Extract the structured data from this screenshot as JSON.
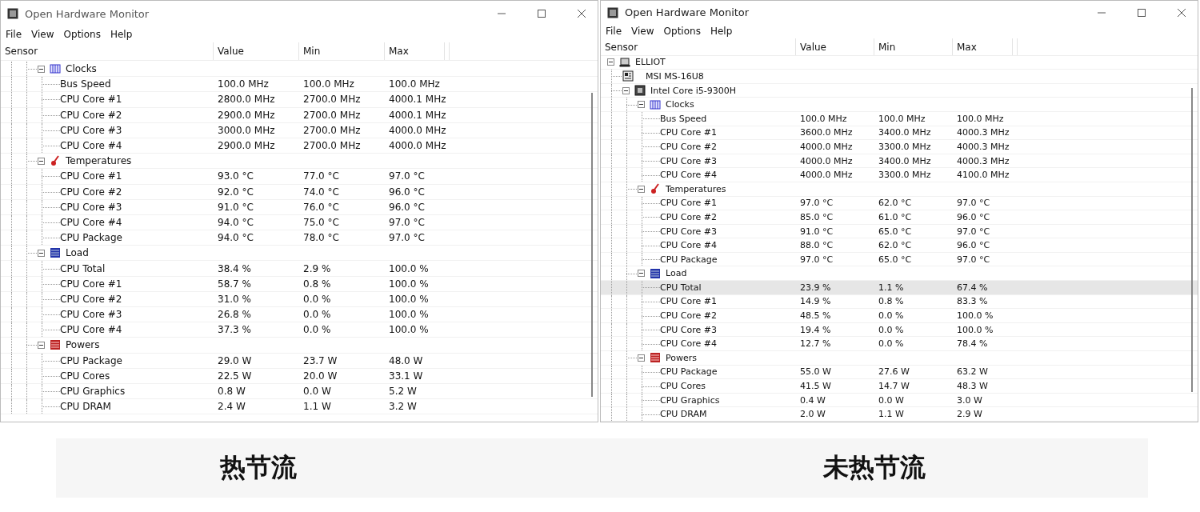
{
  "windows": [
    {
      "title": "Open Hardware Monitor",
      "menu": [
        "File",
        "View",
        "Options",
        "Help"
      ],
      "columns": [
        "Sensor",
        "Value",
        "Min",
        "Max"
      ],
      "caption": "热节流",
      "tree": [
        {
          "kind": "clocks",
          "name": "Clocks",
          "expanded": true,
          "selected": false,
          "children": [
            {
              "kind": "sensor",
              "name": "Bus Speed",
              "value": "100.0 MHz",
              "min": "100.0 MHz",
              "max": "100.0 MHz",
              "selected": false
            },
            {
              "kind": "sensor",
              "name": "CPU Core #1",
              "value": "2800.0 MHz",
              "min": "2700.0 MHz",
              "max": "4000.1 MHz",
              "selected": false
            },
            {
              "kind": "sensor",
              "name": "CPU Core #2",
              "value": "2900.0 MHz",
              "min": "2700.0 MHz",
              "max": "4000.1 MHz",
              "selected": false
            },
            {
              "kind": "sensor",
              "name": "CPU Core #3",
              "value": "3000.0 MHz",
              "min": "2700.0 MHz",
              "max": "4000.0 MHz",
              "selected": false
            },
            {
              "kind": "sensor",
              "name": "CPU Core #4",
              "value": "2900.0 MHz",
              "min": "2700.0 MHz",
              "max": "4000.0 MHz",
              "selected": false
            }
          ]
        },
        {
          "kind": "temperatures",
          "name": "Temperatures",
          "expanded": true,
          "selected": false,
          "children": [
            {
              "kind": "sensor",
              "name": "CPU Core #1",
              "value": "93.0 °C",
              "min": "77.0 °C",
              "max": "97.0 °C",
              "selected": false
            },
            {
              "kind": "sensor",
              "name": "CPU Core #2",
              "value": "92.0 °C",
              "min": "74.0 °C",
              "max": "96.0 °C",
              "selected": false
            },
            {
              "kind": "sensor",
              "name": "CPU Core #3",
              "value": "91.0 °C",
              "min": "76.0 °C",
              "max": "96.0 °C",
              "selected": false
            },
            {
              "kind": "sensor",
              "name": "CPU Core #4",
              "value": "94.0 °C",
              "min": "75.0 °C",
              "max": "97.0 °C",
              "selected": false
            },
            {
              "kind": "sensor",
              "name": "CPU Package",
              "value": "94.0 °C",
              "min": "78.0 °C",
              "max": "97.0 °C",
              "selected": false
            }
          ]
        },
        {
          "kind": "load",
          "name": "Load",
          "expanded": true,
          "selected": false,
          "children": [
            {
              "kind": "sensor",
              "name": "CPU Total",
              "value": "38.4 %",
              "min": "2.9 %",
              "max": "100.0 %",
              "selected": false
            },
            {
              "kind": "sensor",
              "name": "CPU Core #1",
              "value": "58.7 %",
              "min": "0.8 %",
              "max": "100.0 %",
              "selected": false
            },
            {
              "kind": "sensor",
              "name": "CPU Core #2",
              "value": "31.0 %",
              "min": "0.0 %",
              "max": "100.0 %",
              "selected": false
            },
            {
              "kind": "sensor",
              "name": "CPU Core #3",
              "value": "26.8 %",
              "min": "0.0 %",
              "max": "100.0 %",
              "selected": false
            },
            {
              "kind": "sensor",
              "name": "CPU Core #4",
              "value": "37.3 %",
              "min": "0.0 %",
              "max": "100.0 %",
              "selected": false
            }
          ]
        },
        {
          "kind": "powers",
          "name": "Powers",
          "expanded": true,
          "selected": false,
          "children": [
            {
              "kind": "sensor",
              "name": "CPU Package",
              "value": "29.0 W",
              "min": "23.7 W",
              "max": "48.0 W",
              "selected": false
            },
            {
              "kind": "sensor",
              "name": "CPU Cores",
              "value": "22.5 W",
              "min": "20.0 W",
              "max": "33.1 W",
              "selected": false
            },
            {
              "kind": "sensor",
              "name": "CPU Graphics",
              "value": "0.8 W",
              "min": "0.0 W",
              "max": "5.2 W",
              "selected": false
            },
            {
              "kind": "sensor",
              "name": "CPU DRAM",
              "value": "2.4 W",
              "min": "1.1 W",
              "max": "3.2 W",
              "selected": false
            }
          ]
        }
      ]
    },
    {
      "title": "Open Hardware Monitor",
      "menu": [
        "File",
        "View",
        "Options",
        "Help"
      ],
      "columns": [
        "Sensor",
        "Value",
        "Min",
        "Max"
      ],
      "caption": "未热节流",
      "tree": [
        {
          "kind": "computer",
          "name": "ELLIOT",
          "expanded": true,
          "selected": false,
          "children": [
            {
              "kind": "mainboard",
              "name": "MSI MS-16U8",
              "selected": false
            },
            {
              "kind": "cpu",
              "name": "Intel Core i5-9300H",
              "expanded": true,
              "selected": false,
              "children": [
                {
                  "kind": "clocks",
                  "name": "Clocks",
                  "expanded": true,
                  "selected": false,
                  "children": [
                    {
                      "kind": "sensor",
                      "name": "Bus Speed",
                      "value": "100.0 MHz",
                      "min": "100.0 MHz",
                      "max": "100.0 MHz",
                      "selected": false
                    },
                    {
                      "kind": "sensor",
                      "name": "CPU Core #1",
                      "value": "3600.0 MHz",
                      "min": "3400.0 MHz",
                      "max": "4000.3 MHz",
                      "selected": false
                    },
                    {
                      "kind": "sensor",
                      "name": "CPU Core #2",
                      "value": "4000.0 MHz",
                      "min": "3300.0 MHz",
                      "max": "4000.3 MHz",
                      "selected": false
                    },
                    {
                      "kind": "sensor",
                      "name": "CPU Core #3",
                      "value": "4000.0 MHz",
                      "min": "3400.0 MHz",
                      "max": "4000.3 MHz",
                      "selected": false
                    },
                    {
                      "kind": "sensor",
                      "name": "CPU Core #4",
                      "value": "4000.0 MHz",
                      "min": "3300.0 MHz",
                      "max": "4100.0 MHz",
                      "selected": false
                    }
                  ]
                },
                {
                  "kind": "temperatures",
                  "name": "Temperatures",
                  "expanded": true,
                  "selected": false,
                  "children": [
                    {
                      "kind": "sensor",
                      "name": "CPU Core #1",
                      "value": "97.0 °C",
                      "min": "62.0 °C",
                      "max": "97.0 °C",
                      "selected": false
                    },
                    {
                      "kind": "sensor",
                      "name": "CPU Core #2",
                      "value": "85.0 °C",
                      "min": "61.0 °C",
                      "max": "96.0 °C",
                      "selected": false
                    },
                    {
                      "kind": "sensor",
                      "name": "CPU Core #3",
                      "value": "91.0 °C",
                      "min": "65.0 °C",
                      "max": "97.0 °C",
                      "selected": false
                    },
                    {
                      "kind": "sensor",
                      "name": "CPU Core #4",
                      "value": "88.0 °C",
                      "min": "62.0 °C",
                      "max": "96.0 °C",
                      "selected": false
                    },
                    {
                      "kind": "sensor",
                      "name": "CPU Package",
                      "value": "97.0 °C",
                      "min": "65.0 °C",
                      "max": "97.0 °C",
                      "selected": false
                    }
                  ]
                },
                {
                  "kind": "load",
                  "name": "Load",
                  "expanded": true,
                  "selected": false,
                  "children": [
                    {
                      "kind": "sensor",
                      "name": "CPU Total",
                      "value": "23.9 %",
                      "min": "1.1 %",
                      "max": "67.4 %",
                      "selected": true
                    },
                    {
                      "kind": "sensor",
                      "name": "CPU Core #1",
                      "value": "14.9 %",
                      "min": "0.8 %",
                      "max": "83.3 %",
                      "selected": false
                    },
                    {
                      "kind": "sensor",
                      "name": "CPU Core #2",
                      "value": "48.5 %",
                      "min": "0.0 %",
                      "max": "100.0 %",
                      "selected": false
                    },
                    {
                      "kind": "sensor",
                      "name": "CPU Core #3",
                      "value": "19.4 %",
                      "min": "0.0 %",
                      "max": "100.0 %",
                      "selected": false
                    },
                    {
                      "kind": "sensor",
                      "name": "CPU Core #4",
                      "value": "12.7 %",
                      "min": "0.0 %",
                      "max": "78.4 %",
                      "selected": false
                    }
                  ]
                },
                {
                  "kind": "powers",
                  "name": "Powers",
                  "expanded": true,
                  "selected": false,
                  "children": [
                    {
                      "kind": "sensor",
                      "name": "CPU Package",
                      "value": "55.0 W",
                      "min": "27.6 W",
                      "max": "63.2 W",
                      "selected": false
                    },
                    {
                      "kind": "sensor",
                      "name": "CPU Cores",
                      "value": "41.5 W",
                      "min": "14.7 W",
                      "max": "48.3 W",
                      "selected": false
                    },
                    {
                      "kind": "sensor",
                      "name": "CPU Graphics",
                      "value": "0.4 W",
                      "min": "0.0 W",
                      "max": "3.0 W",
                      "selected": false
                    },
                    {
                      "kind": "sensor",
                      "name": "CPU DRAM",
                      "value": "2.0 W",
                      "min": "1.1 W",
                      "max": "2.9 W",
                      "selected": false
                    }
                  ]
                }
              ]
            }
          ]
        }
      ]
    }
  ]
}
